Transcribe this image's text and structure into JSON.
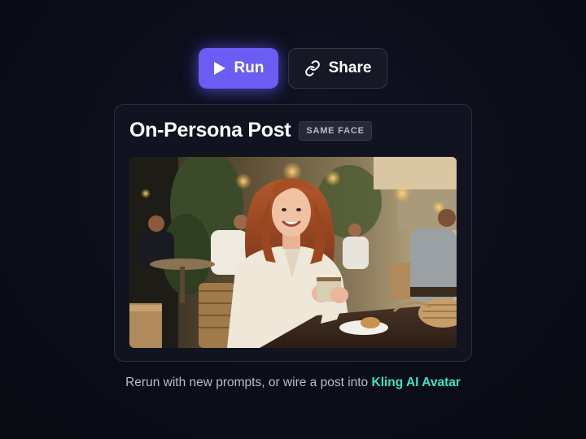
{
  "toolbar": {
    "run_label": "Run",
    "share_label": "Share",
    "run_icon": "play-icon",
    "share_icon": "link-icon",
    "accent_color": "#6b5cf3"
  },
  "card": {
    "title": "On-Persona Post",
    "badge": "SAME FACE",
    "image_description_icon": "photo"
  },
  "footer": {
    "text": "Rerun with new prompts, or wire a post into",
    "link_label": "Kling AI Avatar",
    "link_color": "#3fe0c5"
  }
}
